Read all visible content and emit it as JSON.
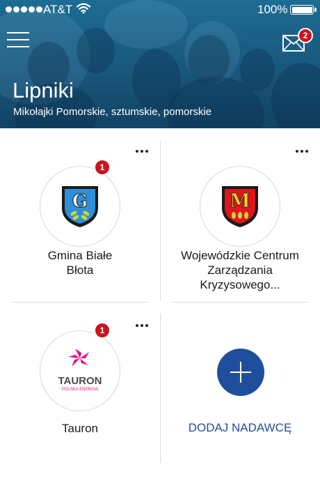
{
  "status_bar": {
    "carrier": "AT&T",
    "battery": "100%"
  },
  "header": {
    "title": "Lipniki",
    "subtitle": "Mikołajki Pomorskie, sztumskie, pomorskie",
    "mail_badge": "2"
  },
  "senders": [
    {
      "name_line1": "Gmina Białe",
      "name_line2": "Błota",
      "name_line3": "",
      "badge": "1",
      "logo_letter": "G"
    },
    {
      "name_line1": "Wojewódzkie Centrum",
      "name_line2": "Zarządzania",
      "name_line3": "Kryzysowego...",
      "badge": "",
      "logo_letter": "M"
    },
    {
      "name_line1": "Tauron",
      "name_line2": "",
      "name_line3": "",
      "badge": "1",
      "logo_text": "TAURON",
      "logo_subtext": "POLSKA ENERGIA"
    }
  ],
  "add_sender": {
    "label": "DODAJ NADAWCĘ"
  },
  "colors": {
    "accent": "#1f4e9c",
    "badge": "#c8141e",
    "header": "#1d5f84",
    "divider": "#d9d9d9"
  },
  "icons": {
    "menu": "hamburger-icon",
    "mail": "envelope-icon",
    "more": "more-dots-icon",
    "add": "plus-icon",
    "wifi": "wifi-icon",
    "battery": "battery-icon"
  }
}
